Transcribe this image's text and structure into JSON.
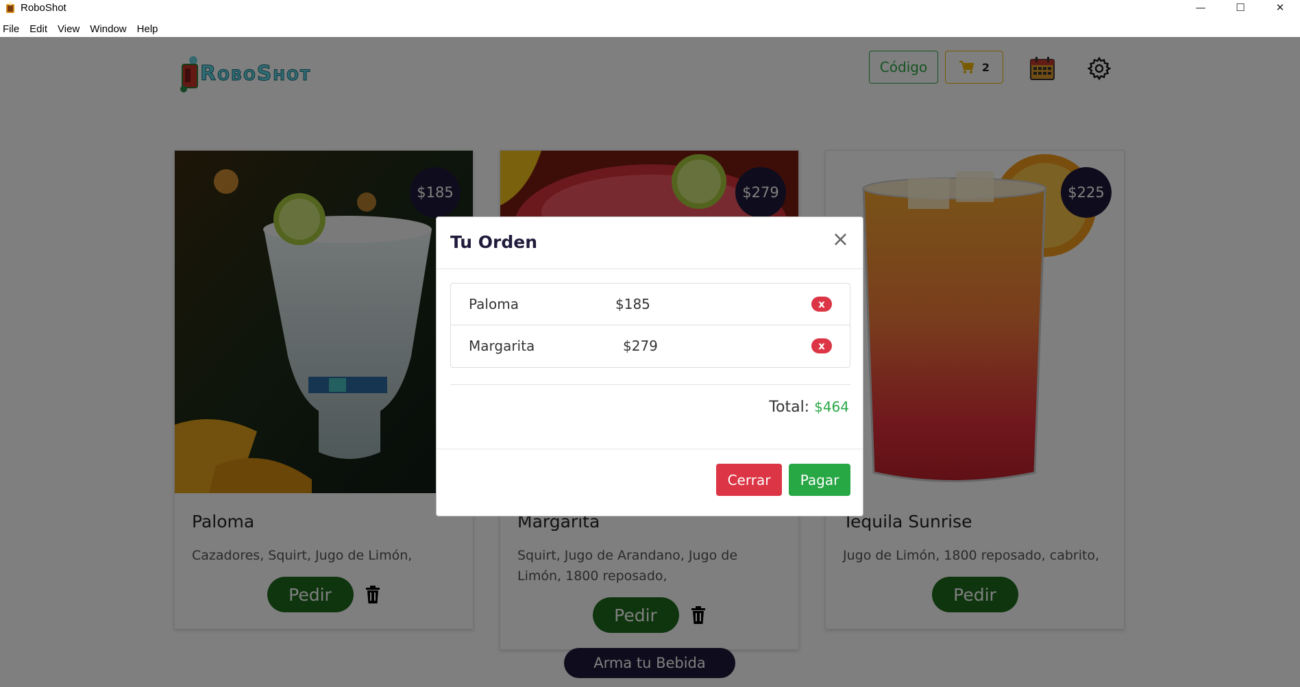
{
  "window": {
    "title": "RoboShot",
    "controls": {
      "minimize": "—",
      "maximize": "☐",
      "close": "✕"
    }
  },
  "menubar": {
    "items": [
      "File",
      "Edit",
      "View",
      "Window",
      "Help"
    ]
  },
  "header": {
    "logo_text": "RoboShot",
    "codigo_label": "Código",
    "cart_count": "2"
  },
  "cards": [
    {
      "name": "Paloma",
      "price": "$185",
      "desc": "Cazadores, Squirt, Jugo de Limón,",
      "action": "Pedir",
      "has_delete": true
    },
    {
      "name": "Margarita",
      "price": "$279",
      "desc": "Squirt, Jugo de Arandano, Jugo de Limón, 1800 reposado,",
      "action": "Pedir",
      "has_delete": true
    },
    {
      "name": "Tequila Sunrise",
      "price": "$225",
      "desc": "Jugo de Limón, 1800 reposado, cabrito,",
      "action": "Pedir",
      "has_delete": false
    }
  ],
  "arma_label": "Arma tu Bebida",
  "modal": {
    "title": "Tu Orden",
    "close": "×",
    "items": [
      {
        "name": "Paloma",
        "price": "$185",
        "delete_label": "x"
      },
      {
        "name": "Margarita",
        "price": "$279",
        "delete_label": "x"
      }
    ],
    "total_label": "Total:",
    "total_value": "$464",
    "cerrar_label": "Cerrar",
    "pagar_label": "Pagar"
  },
  "colors": {
    "primary_dark": "#1f1b3b",
    "success": "#28a745",
    "danger": "#dc3545",
    "pedir": "#1d6b1d",
    "cart_border": "#f0b400"
  }
}
